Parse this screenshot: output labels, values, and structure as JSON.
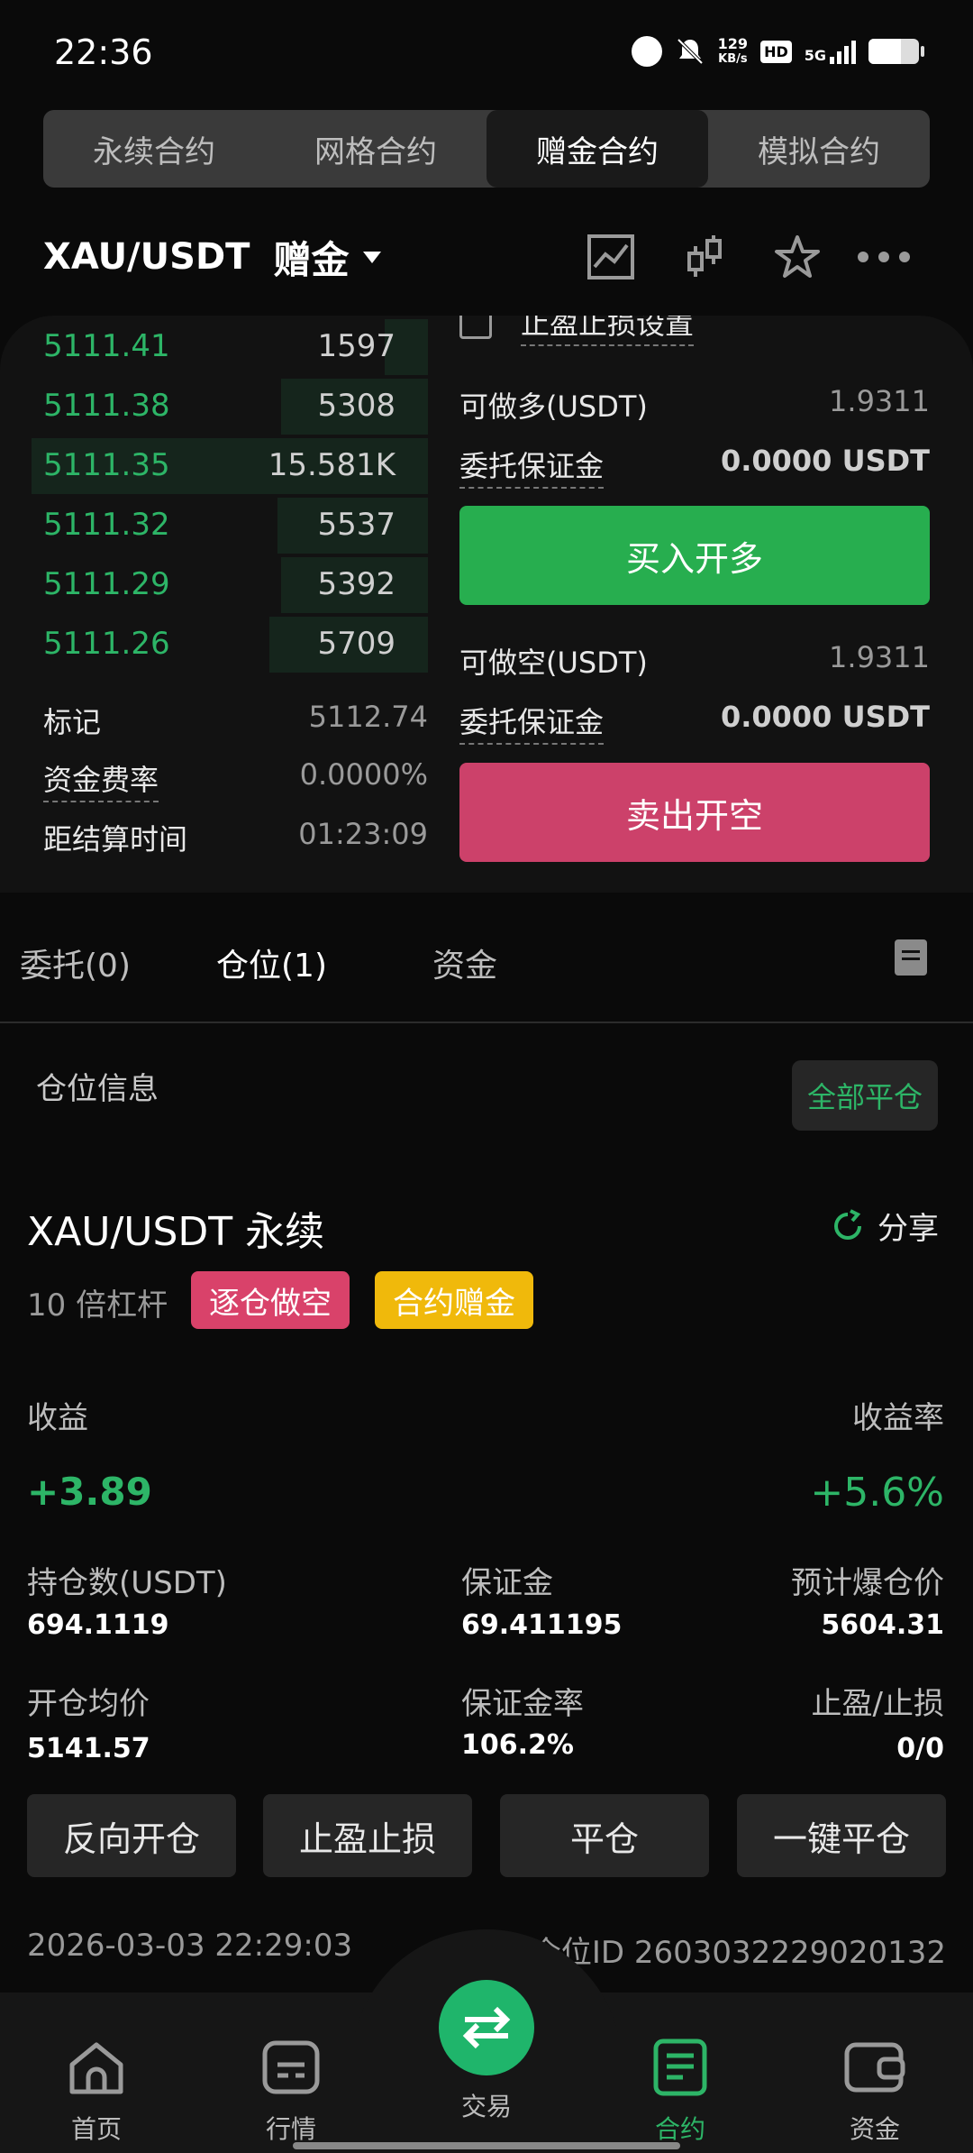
{
  "status_bar": {
    "time": "22:36",
    "net_speed_value": "129",
    "net_speed_unit": "KB/s",
    "hd": "HD",
    "network": "5G"
  },
  "tabs": [
    {
      "label": "永续合约",
      "active": false
    },
    {
      "label": "网格合约",
      "active": false
    },
    {
      "label": "赠金合约",
      "active": true
    },
    {
      "label": "模拟合约",
      "active": false
    }
  ],
  "pair": {
    "name": "XAU/USDT",
    "bonus_label": "赠金"
  },
  "orderbook": {
    "partial_header": "止盈止损设置",
    "rows": [
      {
        "price": "5111.41",
        "qty": "1597",
        "depth": 0.08
      },
      {
        "price": "5111.38",
        "qty": "5308",
        "depth": 0.37
      },
      {
        "price": "5111.35",
        "qty": "15.581K",
        "depth": 1.0
      },
      {
        "price": "5111.32",
        "qty": "5537",
        "depth": 0.38
      },
      {
        "price": "5111.29",
        "qty": "5392",
        "depth": 0.37
      },
      {
        "price": "5111.26",
        "qty": "5709",
        "depth": 0.4
      }
    ]
  },
  "market_info": {
    "mark_label": "标记",
    "mark_value": "5112.74",
    "funding_label": "资金费率",
    "funding_value": "0.0000%",
    "settle_label": "距结算时间",
    "settle_value": "01:23:09"
  },
  "order_form": {
    "long_available_label": "可做多(USDT)",
    "long_available_value": "1.9311",
    "long_margin_label": "委托保证金",
    "long_margin_value": "0.0000 USDT",
    "buy_button": "买入开多",
    "short_available_label": "可做空(USDT)",
    "short_available_value": "1.9311",
    "short_margin_label": "委托保证金",
    "short_margin_value": "0.0000 USDT",
    "sell_button": "卖出开空"
  },
  "order_tabs": [
    {
      "label": "委托(0)",
      "active": false
    },
    {
      "label": "仓位(1)",
      "active": true
    },
    {
      "label": "资金",
      "active": false
    }
  ],
  "position_section": {
    "title": "仓位信息",
    "close_all": "全部平仓"
  },
  "position": {
    "symbol": "XAU/USDT 永续",
    "share": "分享",
    "leverage": "10 倍杠杆",
    "mode_tag": "逐仓做空",
    "bonus_tag": "合约赠金",
    "pnl_label": "收益",
    "pnl_value": "+3.89",
    "roe_label": "收益率",
    "roe_value": "+5.6%",
    "size_label": "持仓数(USDT)",
    "size_value": "694.1119",
    "margin_label": "保证金",
    "margin_value": "69.411195",
    "liq_label": "预计爆仓价",
    "liq_value": "5604.31",
    "entry_label": "开仓均价",
    "entry_value": "5141.57",
    "margin_rate_label": "保证金率",
    "margin_rate_value": "106.2%",
    "tpsl_label": "止盈/止损",
    "tpsl_value": "0/0",
    "actions": [
      "反向开仓",
      "止盈止损",
      "平仓",
      "一键平仓"
    ],
    "time": "2026-03-03 22:29:03",
    "position_id": "仓位ID 2603032229020132"
  },
  "bottom_nav": [
    {
      "label": "首页",
      "icon": "home-icon"
    },
    {
      "label": "行情",
      "icon": "market-icon"
    },
    {
      "label": "交易",
      "icon": "swap-icon"
    },
    {
      "label": "合约",
      "icon": "contract-icon",
      "active": true
    },
    {
      "label": "资金",
      "icon": "wallet-icon"
    }
  ],
  "colors": {
    "green": "#2db567",
    "red": "#d9426a",
    "yellow": "#f0b90b",
    "buy": "#27ae4f",
    "sell": "#d9426a"
  }
}
